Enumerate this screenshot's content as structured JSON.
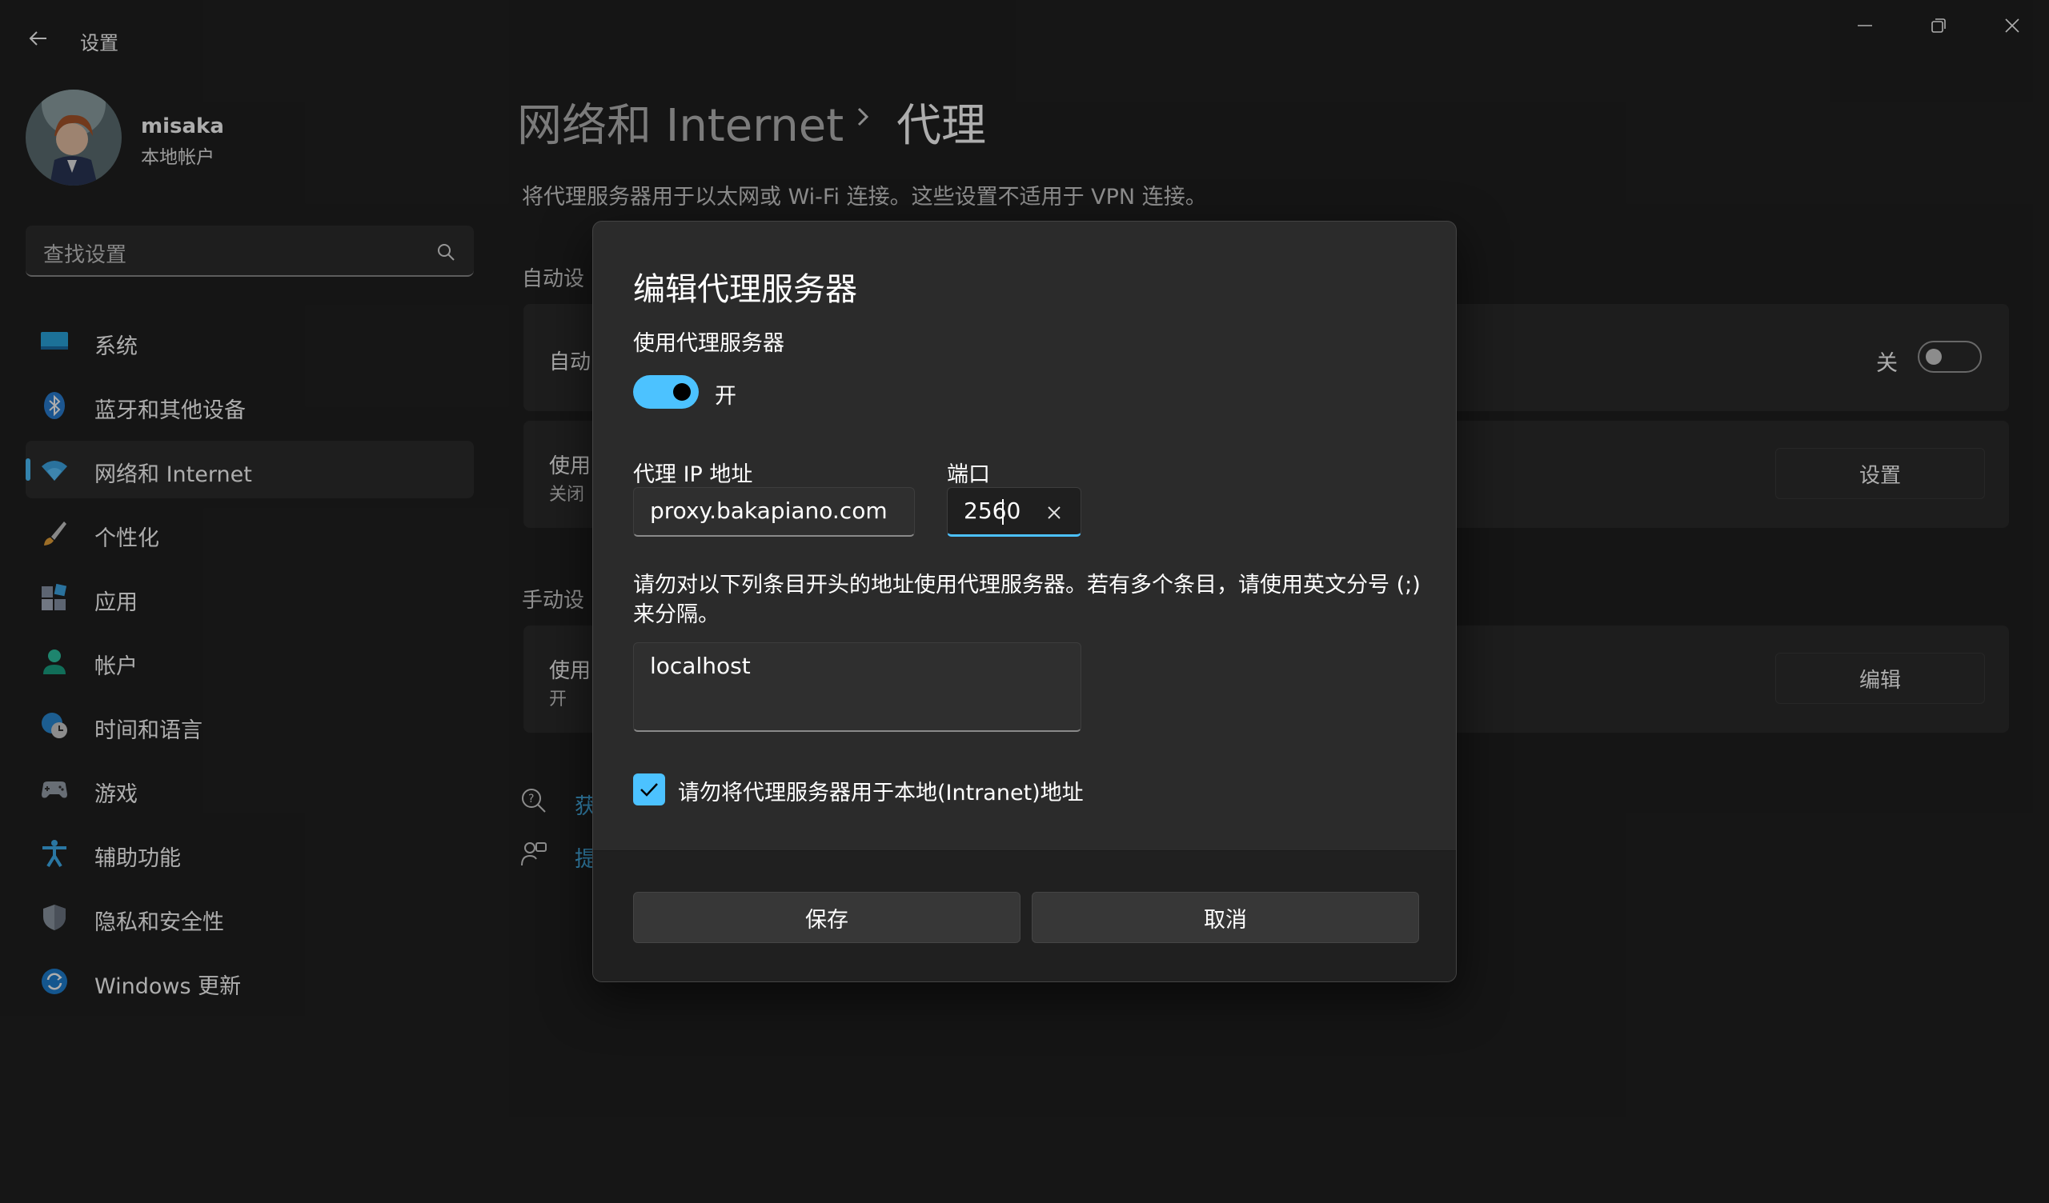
{
  "window": {
    "title": "设置",
    "minimize_icon": "minimize-icon",
    "maximize_icon": "restore-icon",
    "close_icon": "close-icon"
  },
  "user": {
    "name": "misaka",
    "account_type": "本地帐户"
  },
  "search": {
    "placeholder": "查找设置"
  },
  "sidebar": {
    "items": [
      {
        "label": "系统",
        "icon": "monitor-icon",
        "active": false
      },
      {
        "label": "蓝牙和其他设备",
        "icon": "bluetooth-icon",
        "active": false
      },
      {
        "label": "网络和 Internet",
        "icon": "wifi-icon",
        "active": true
      },
      {
        "label": "个性化",
        "icon": "brush-icon",
        "active": false
      },
      {
        "label": "应用",
        "icon": "apps-icon",
        "active": false
      },
      {
        "label": "帐户",
        "icon": "person-icon",
        "active": false
      },
      {
        "label": "时间和语言",
        "icon": "globe-clock-icon",
        "active": false
      },
      {
        "label": "游戏",
        "icon": "gamepad-icon",
        "active": false
      },
      {
        "label": "辅助功能",
        "icon": "accessibility-icon",
        "active": false
      },
      {
        "label": "隐私和安全性",
        "icon": "shield-icon",
        "active": false
      },
      {
        "label": "Windows 更新",
        "icon": "update-icon",
        "active": false
      }
    ]
  },
  "main": {
    "breadcrumb_parent": "网络和 Internet",
    "breadcrumb_current": "代理",
    "description": "将代理服务器用于以太网或 Wi-Fi 连接。这些设置不适用于 VPN 连接。",
    "auto_section_label": "自动设",
    "auto_card_title": "自动",
    "auto_toggle_label": "关",
    "script_card_title": "使用",
    "script_card_sub": "关闭",
    "script_button": "设置",
    "manual_section_label": "手动设",
    "manual_card_title": "使用",
    "manual_card_sub": "开",
    "manual_button": "编辑",
    "link_help": "获",
    "link_feedback": "提"
  },
  "dialog": {
    "title": "编辑代理服务器",
    "use_proxy_label": "使用代理服务器",
    "toggle_state": "开",
    "ip_label": "代理 IP 地址",
    "ip_value": "proxy.bakapiano.com",
    "port_label": "端口",
    "port_value": "2560",
    "exceptions_info": "请勿对以下列条目开头的地址使用代理服务器。若有多个条目，请使用英文分号 (;) 来分隔。",
    "exceptions_value": "localhost",
    "intranet_checked": true,
    "intranet_label": "请勿将代理服务器用于本地(Intranet)地址",
    "save_button": "保存",
    "cancel_button": "取消"
  },
  "colors": {
    "accent": "#4cc2ff",
    "background": "#202020",
    "card": "#2b2b2b"
  }
}
